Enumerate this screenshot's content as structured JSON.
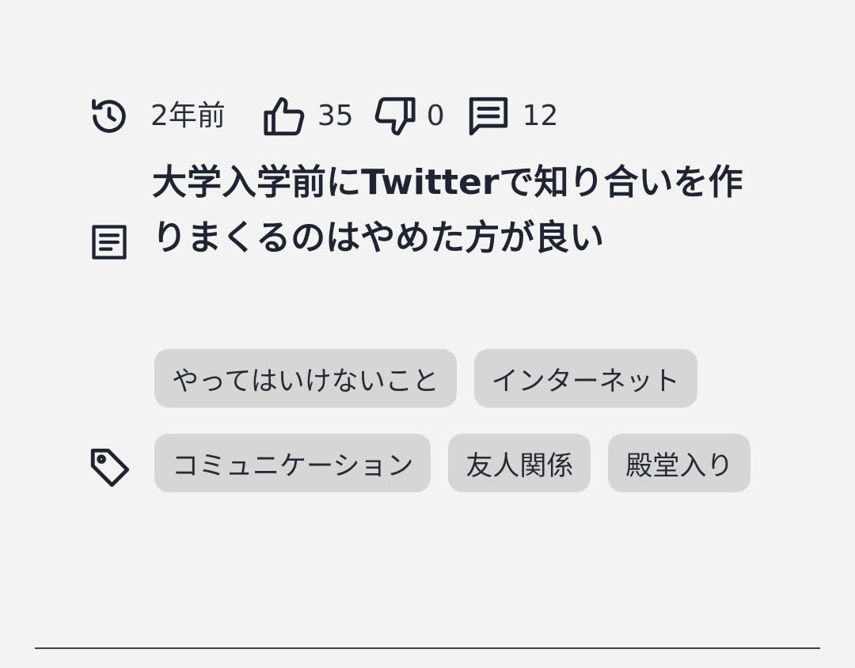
{
  "meta": {
    "posted": "2年前",
    "likes": "35",
    "dislikes": "0",
    "comments": "12"
  },
  "post": {
    "title": "大学入学前にTwitterで知り合いを作りまくるのはやめた方が良い"
  },
  "tags": [
    "やってはいけないこと",
    "インターネット",
    "コミュニケーション",
    "友人関係",
    "殿堂入り"
  ],
  "icons": {
    "history": "history-icon",
    "like": "thumbs-up-icon",
    "dislike": "thumbs-down-icon",
    "comment": "comment-icon",
    "article": "article-icon",
    "tag": "tag-icon"
  },
  "colors": {
    "background": "#f3f3f3",
    "text": "#1f2530",
    "tag_background": "#d6d6d6"
  }
}
